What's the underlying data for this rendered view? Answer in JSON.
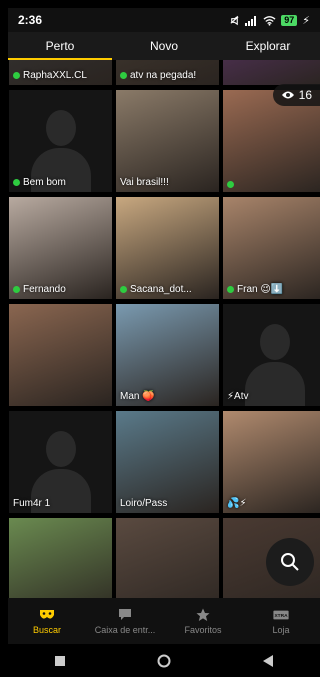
{
  "status_bar": {
    "time": "2:36",
    "battery": "97"
  },
  "tabs": [
    {
      "label": "Perto",
      "active": true
    },
    {
      "label": "Novo",
      "active": false
    },
    {
      "label": "Explorar",
      "active": false
    }
  ],
  "viewer_count": "16",
  "grid": [
    {
      "label": "RaphaXXL.CL",
      "online": true,
      "bg": "#3a3a3a",
      "placeholder": false
    },
    {
      "label": "atv na pegada!",
      "online": true,
      "bg": "#4a4036",
      "placeholder": false
    },
    {
      "label": "",
      "online": false,
      "bg": "#6a3a7a",
      "placeholder": false
    },
    {
      "label": "Bem bom",
      "online": true,
      "bg": "#151515",
      "placeholder": true
    },
    {
      "label": "Vai brasil!!!",
      "online": false,
      "bg": "#8a7a68",
      "placeholder": false
    },
    {
      "label": "",
      "online": true,
      "bg": "#9a6a52",
      "placeholder": false
    },
    {
      "label": "Fernando",
      "online": true,
      "bg": "#b8aaa0",
      "placeholder": false
    },
    {
      "label": "Sacana_dot...",
      "online": true,
      "bg": "#c8a880",
      "placeholder": false
    },
    {
      "label": "Fran 😉⬇️",
      "online": true,
      "bg": "#a8846a",
      "placeholder": false
    },
    {
      "label": "",
      "online": false,
      "bg": "#8a6650",
      "placeholder": false
    },
    {
      "label": "Man 🍑",
      "online": false,
      "bg": "#7a9ab0",
      "placeholder": false
    },
    {
      "label": "⚡Atv",
      "online": false,
      "bg": "#151515",
      "placeholder": true
    },
    {
      "label": "Fum4r 1",
      "online": false,
      "bg": "#151515",
      "placeholder": true
    },
    {
      "label": "Loiro/Pass",
      "online": false,
      "bg": "#5a7a8a",
      "placeholder": false
    },
    {
      "label": "💦⚡",
      "online": false,
      "bg": "#b08a6e",
      "placeholder": false
    },
    {
      "label": "",
      "online": false,
      "bg": "#6a8a50",
      "placeholder": false
    },
    {
      "label": "",
      "online": false,
      "bg": "#5a4a40",
      "placeholder": false
    },
    {
      "label": "",
      "online": false,
      "bg": "#4a3a32",
      "placeholder": false
    }
  ],
  "bottom_nav": [
    {
      "label": "Buscar",
      "icon": "mask-icon",
      "active": true
    },
    {
      "label": "Caixa de entr...",
      "icon": "chat-icon",
      "active": false
    },
    {
      "label": "Favoritos",
      "icon": "star-icon",
      "active": false
    },
    {
      "label": "Loja",
      "icon": "xtra-icon",
      "active": false
    }
  ],
  "colors": {
    "accent": "#ffcc00",
    "online": "#2ecc40"
  }
}
